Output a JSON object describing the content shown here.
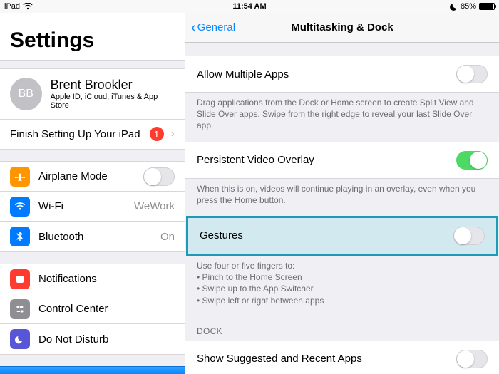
{
  "status": {
    "device": "iPad",
    "time": "11:54 AM",
    "battery_pct": "85%"
  },
  "sidebar": {
    "title": "Settings",
    "profile": {
      "initials": "BB",
      "name": "Brent Brookler",
      "subtitle": "Apple ID, iCloud, iTunes & App Store"
    },
    "finish_setup": {
      "label": "Finish Setting Up Your iPad",
      "badge": "1"
    },
    "airplane": {
      "label": "Airplane Mode"
    },
    "wifi": {
      "label": "Wi-Fi",
      "value": "WeWork"
    },
    "bluetooth": {
      "label": "Bluetooth",
      "value": "On"
    },
    "notifications": {
      "label": "Notifications"
    },
    "control_center": {
      "label": "Control Center"
    },
    "dnd": {
      "label": "Do Not Disturb"
    }
  },
  "main": {
    "back_label": "General",
    "title": "Multitasking & Dock",
    "allow_multiple": {
      "label": "Allow Multiple Apps",
      "footer": "Drag applications from the Dock or Home screen to create Split View and Slide Over apps. Swipe from the right edge to reveal your last Slide Over app."
    },
    "pvo": {
      "label": "Persistent Video Overlay",
      "footer": "When this is on, videos will continue playing in an overlay, even when you press the Home button."
    },
    "gestures": {
      "label": "Gestures",
      "footer_intro": "Use four or five fingers to:",
      "footer_items": [
        "Pinch to the Home Screen",
        "Swipe up to the App Switcher",
        "Swipe left or right between apps"
      ]
    },
    "dock_header": "DOCK",
    "suggested": {
      "label": "Show Suggested and Recent Apps"
    }
  }
}
